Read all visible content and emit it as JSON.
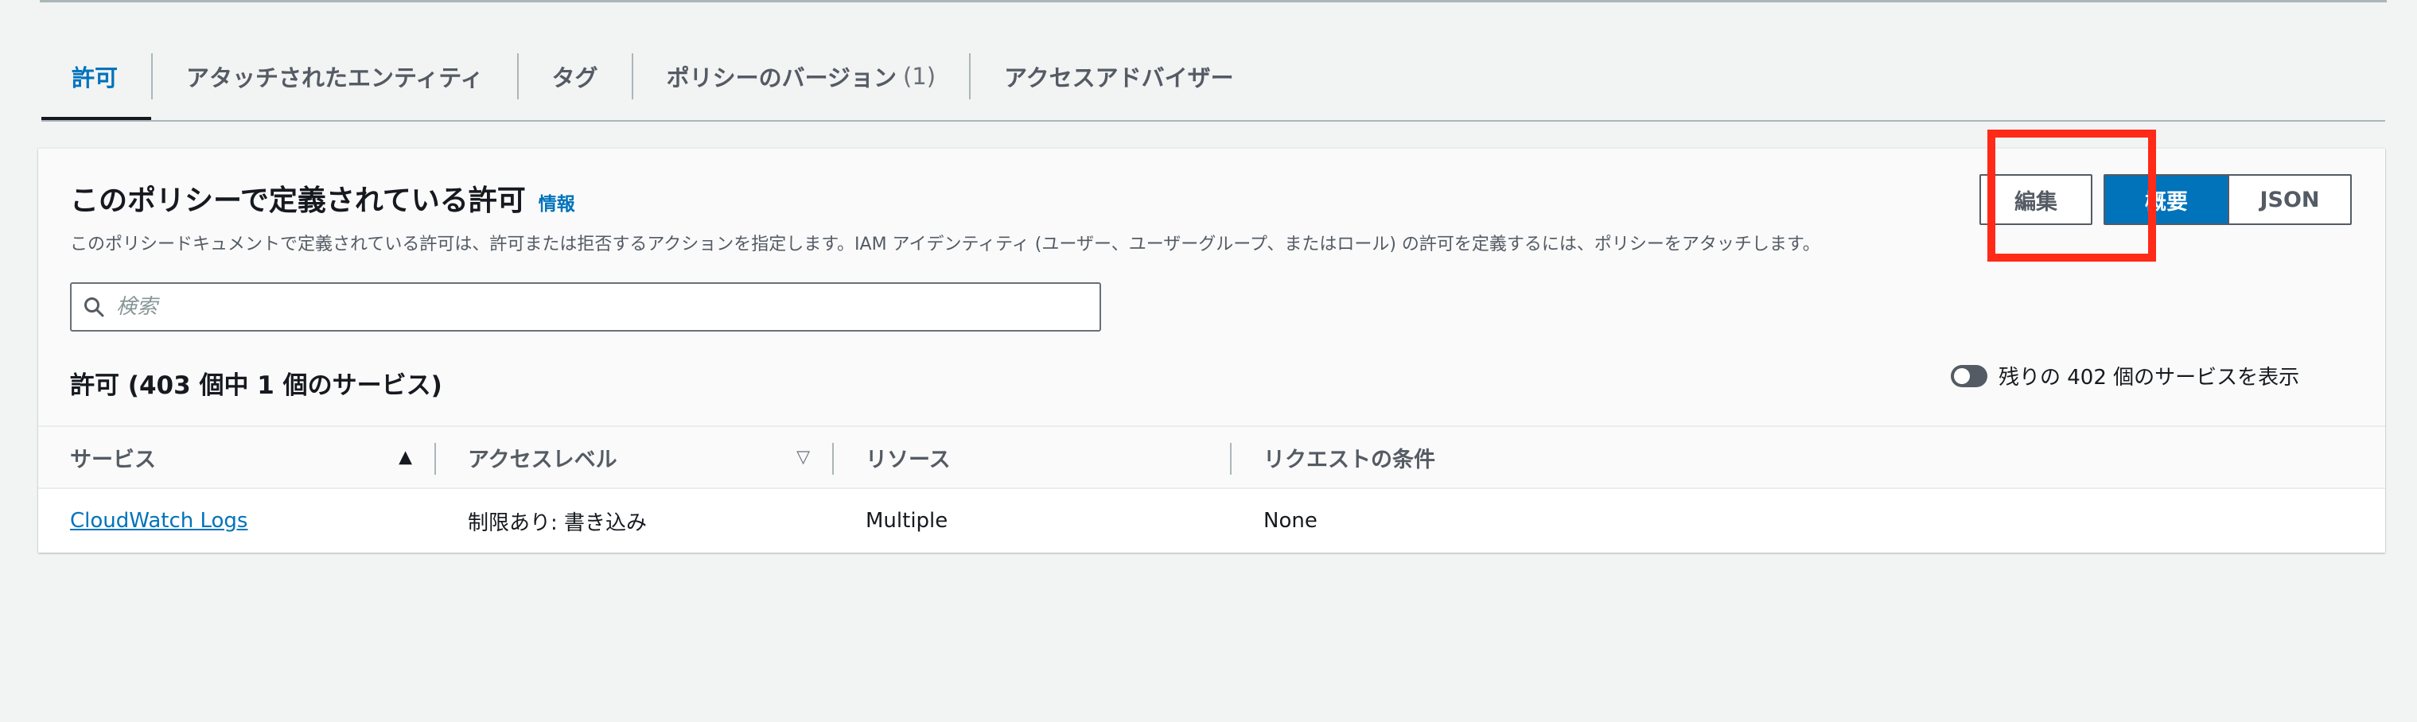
{
  "tabs": [
    {
      "label": "許可"
    },
    {
      "label": "アタッチされたエンティティ"
    },
    {
      "label": "タグ"
    },
    {
      "label": "ポリシーのバージョン",
      "count": "(1)"
    },
    {
      "label": "アクセスアドバイザー"
    }
  ],
  "panel": {
    "title": "このポリシーで定義されている許可",
    "info": "情報",
    "description": "このポリシードキュメントで定義されている許可は、許可または拒否するアクションを指定します。IAM アイデンティティ (ユーザー、ユーザーグループ、またはロール) の許可を定義するには、ポリシーをアタッチします。",
    "edit_label": "編集",
    "view_summary": "概要",
    "view_json": "JSON",
    "search_placeholder": "検索",
    "count_title": "許可 (403 個中 1 個のサービス)",
    "toggle_label": "残りの 402 個のサービスを表示"
  },
  "table": {
    "headers": {
      "service": "サービス",
      "access_level": "アクセスレベル",
      "resource": "リソース",
      "condition": "リクエストの条件"
    },
    "rows": [
      {
        "service": "CloudWatch Logs",
        "access_level": "制限あり: 書き込み",
        "resource": "Multiple",
        "condition": "None"
      }
    ]
  },
  "colors": {
    "accent": "#0073bb",
    "highlight": "#ff2a17"
  }
}
